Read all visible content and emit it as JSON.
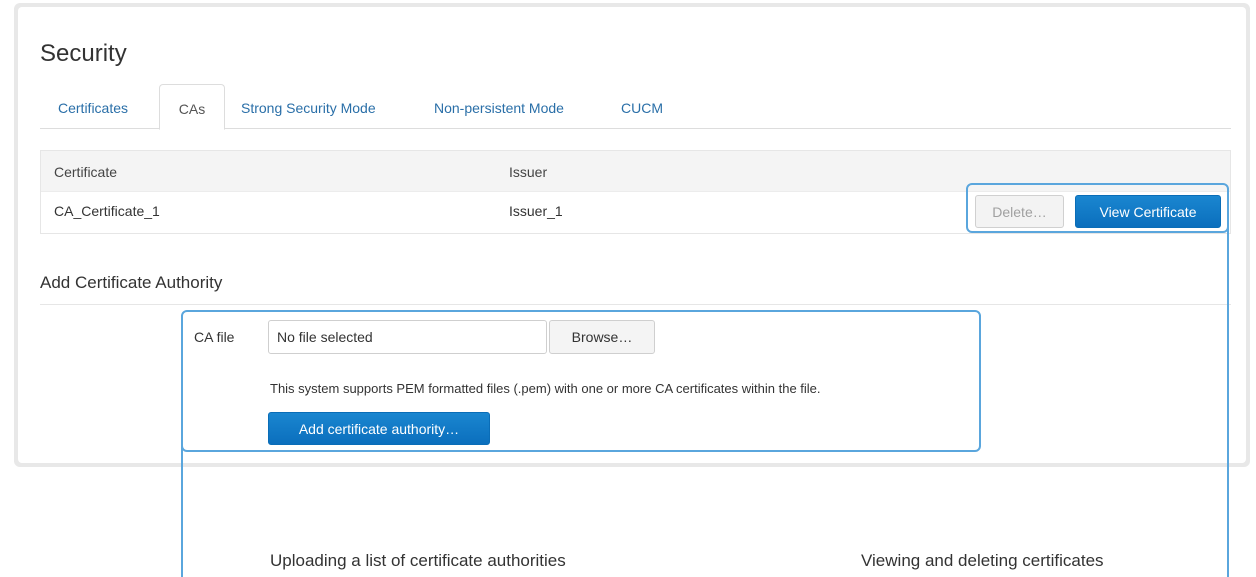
{
  "page": {
    "title": "Security"
  },
  "tabs": [
    {
      "label": "Certificates",
      "active": false
    },
    {
      "label": "CAs",
      "active": true
    },
    {
      "label": "Strong Security Mode",
      "active": false
    },
    {
      "label": "Non-persistent Mode",
      "active": false
    },
    {
      "label": "CUCM",
      "active": false
    }
  ],
  "cert_table": {
    "columns": [
      "Certificate",
      "Issuer"
    ],
    "rows": [
      {
        "certificate": "CA_Certificate_1",
        "issuer": "Issuer_1"
      }
    ],
    "delete_label": "Delete…",
    "view_label": "View Certificate"
  },
  "add_ca": {
    "title": "Add Certificate Authority",
    "file_label": "CA file",
    "file_value": "No file selected",
    "browse_label": "Browse…",
    "hint": "This system supports PEM formatted files (.pem) with one or more CA certificates within the file.",
    "submit_label": "Add certificate authority…"
  },
  "callouts": {
    "upload": "Uploading a list of certificate authorities",
    "view_delete": "Viewing and deleting certificates"
  },
  "colors": {
    "accent": "#0b6fbd",
    "link": "#2a6fa8",
    "callout": "#5aa6dd"
  }
}
